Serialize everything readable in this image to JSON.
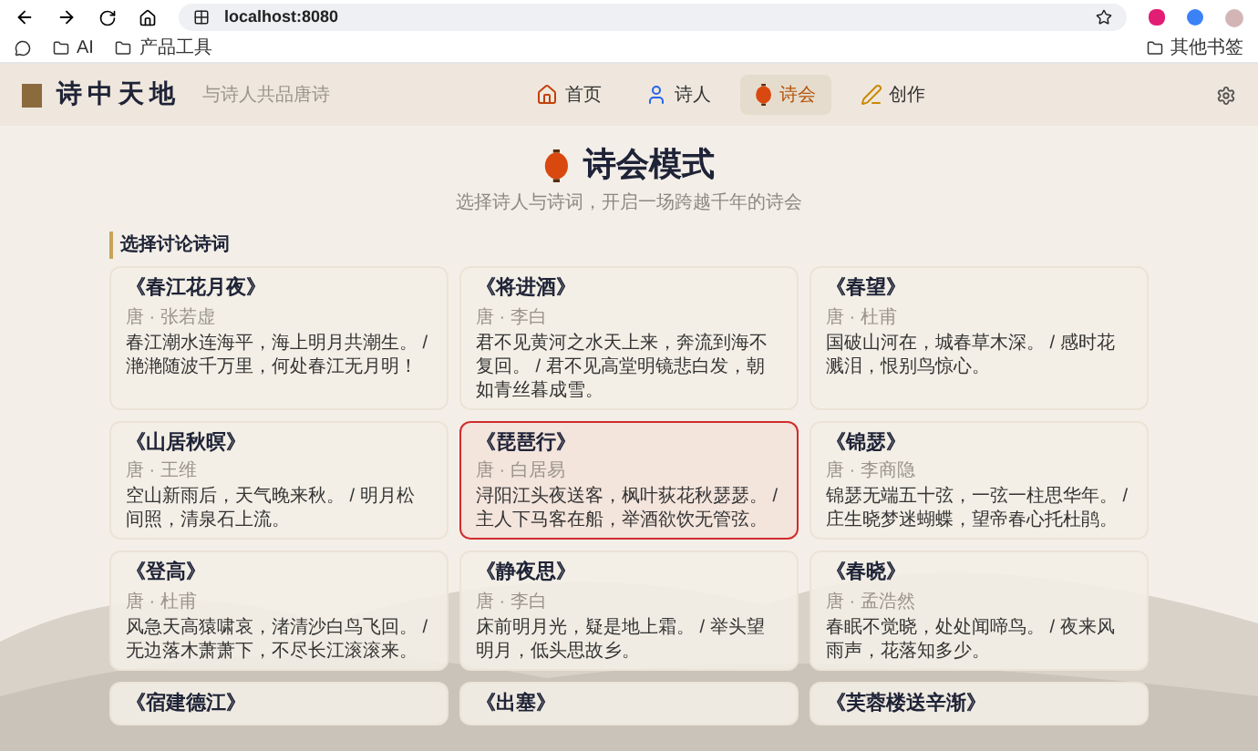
{
  "browser": {
    "url": "localhost:8080",
    "bookmarks": [
      "AI",
      "产品工具"
    ],
    "other_bookmarks": "其他书签"
  },
  "header": {
    "logo": "诗中天地",
    "tagline": "与诗人共品唐诗",
    "nav": [
      {
        "label": "首页",
        "kind": "home",
        "selected": false
      },
      {
        "label": "诗人",
        "kind": "user",
        "selected": false
      },
      {
        "label": "诗会",
        "kind": "lantern",
        "selected": true
      },
      {
        "label": "创作",
        "kind": "pen",
        "selected": false
      }
    ]
  },
  "hero": {
    "title": "诗会模式",
    "subtitle": "选择诗人与诗词，开启一场跨越千年的诗会"
  },
  "section": {
    "title": "选择讨论诗词",
    "poems": [
      {
        "title": "《春江花月夜》",
        "author": "唐 · 张若虚",
        "excerpt": "春江潮水连海平，海上明月共潮生。 / 滟滟随波千万里，何处春江无月明！",
        "selected": false
      },
      {
        "title": "《将进酒》",
        "author": "唐 · 李白",
        "excerpt": "君不见黄河之水天上来，奔流到海不复回。 / 君不见高堂明镜悲白发，朝如青丝暮成雪。",
        "selected": false
      },
      {
        "title": "《春望》",
        "author": "唐 · 杜甫",
        "excerpt": "国破山河在，城春草木深。 / 感时花溅泪，恨别鸟惊心。",
        "selected": false
      },
      {
        "title": "《山居秋暝》",
        "author": "唐 · 王维",
        "excerpt": "空山新雨后，天气晚来秋。 / 明月松间照，清泉石上流。",
        "selected": false
      },
      {
        "title": "《琵琶行》",
        "author": "唐 · 白居易",
        "excerpt": "浔阳江头夜送客，枫叶荻花秋瑟瑟。 / 主人下马客在船，举酒欲饮无管弦。",
        "selected": true
      },
      {
        "title": "《锦瑟》",
        "author": "唐 · 李商隐",
        "excerpt": "锦瑟无端五十弦，一弦一柱思华年。 / 庄生晓梦迷蝴蝶，望帝春心托杜鹃。",
        "selected": false
      },
      {
        "title": "《登高》",
        "author": "唐 · 杜甫",
        "excerpt": "风急天高猿啸哀，渚清沙白鸟飞回。 / 无边落木萧萧下，不尽长江滚滚来。",
        "selected": false
      },
      {
        "title": "《静夜思》",
        "author": "唐 · 李白",
        "excerpt": "床前明月光，疑是地上霜。 / 举头望明月，低头思故乡。",
        "selected": false
      },
      {
        "title": "《春晓》",
        "author": "唐 · 孟浩然",
        "excerpt": "春眠不觉晓，处处闻啼鸟。 / 夜来风雨声，花落知多少。",
        "selected": false
      },
      {
        "title": "《宿建德江》",
        "selected": false
      },
      {
        "title": "《出塞》",
        "selected": false
      },
      {
        "title": "《芙蓉楼送辛渐》",
        "selected": false
      }
    ]
  }
}
